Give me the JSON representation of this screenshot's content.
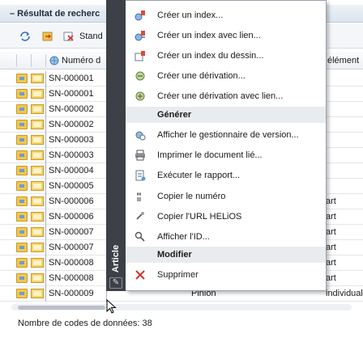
{
  "panel": {
    "title": "– Résultat de recherc",
    "toolbar_label": "Stand",
    "column_number": "Numéro d",
    "column_element": "élément",
    "rows": [
      {
        "number": "SN-000001",
        "mid": "",
        "right": ""
      },
      {
        "number": "SN-000001",
        "mid": "",
        "right": ""
      },
      {
        "number": "SN-000002",
        "mid": "",
        "right": ""
      },
      {
        "number": "SN-000002",
        "mid": "",
        "right": ""
      },
      {
        "number": "SN-000003",
        "mid": "",
        "right": ""
      },
      {
        "number": "SN-000003",
        "mid": "",
        "right": ""
      },
      {
        "number": "SN-000004",
        "mid": "",
        "right": ""
      },
      {
        "number": "SN-000005",
        "mid": "",
        "right": ""
      },
      {
        "number": "SN-000006",
        "mid": "",
        "right": "art"
      },
      {
        "number": "SN-000006",
        "mid": "",
        "right": "art"
      },
      {
        "number": "SN-000007",
        "mid": "",
        "right": "art"
      },
      {
        "number": "SN-000007",
        "mid": "",
        "right": "art"
      },
      {
        "number": "SN-000008",
        "mid": "",
        "right": "art"
      },
      {
        "number": "SN-000008",
        "mid": "",
        "right": "art"
      },
      {
        "number": "SN-000009",
        "mid": "Pinion",
        "right": "individual part"
      }
    ],
    "footer": "Nombre de codes de données: 38"
  },
  "sidebar": {
    "label": "Article",
    "pin_icon": "pin-icon"
  },
  "menu": {
    "items": [
      {
        "type": "item",
        "label": "Créer un index...",
        "icon": "create-index-icon"
      },
      {
        "type": "item",
        "label": "Créer un index avec lien...",
        "icon": "create-index-link-icon"
      },
      {
        "type": "item",
        "label": "Créer un index du dessin...",
        "icon": "create-drawing-index-icon"
      },
      {
        "type": "item",
        "label": "Créer une dérivation...",
        "icon": "create-derivation-icon"
      },
      {
        "type": "item",
        "label": "Créer une dérivation avec lien...",
        "icon": "create-derivation-link-icon"
      },
      {
        "type": "section",
        "label": "Générer"
      },
      {
        "type": "item",
        "label": "Afficher le gestionnaire de version...",
        "icon": "version-manager-icon"
      },
      {
        "type": "item",
        "label": "Imprimer le document lié...",
        "icon": "printer-icon"
      },
      {
        "type": "item",
        "label": "Exécuter le rapport...",
        "icon": "report-icon"
      },
      {
        "type": "item",
        "label": "Copier le numéro",
        "icon": "copy-number-icon"
      },
      {
        "type": "item",
        "label": "Copier l'URL HELiOS",
        "icon": "copy-url-icon"
      },
      {
        "type": "item",
        "label": "Afficher l'ID...",
        "icon": "show-id-icon"
      },
      {
        "type": "section",
        "label": "Modifier"
      },
      {
        "type": "item",
        "label": "Supprimer",
        "icon": "delete-icon"
      }
    ]
  },
  "colors": {
    "sidebar_bg": "#3d4046",
    "section_bg": "#e9ecef",
    "delete_red": "#d0352d"
  }
}
